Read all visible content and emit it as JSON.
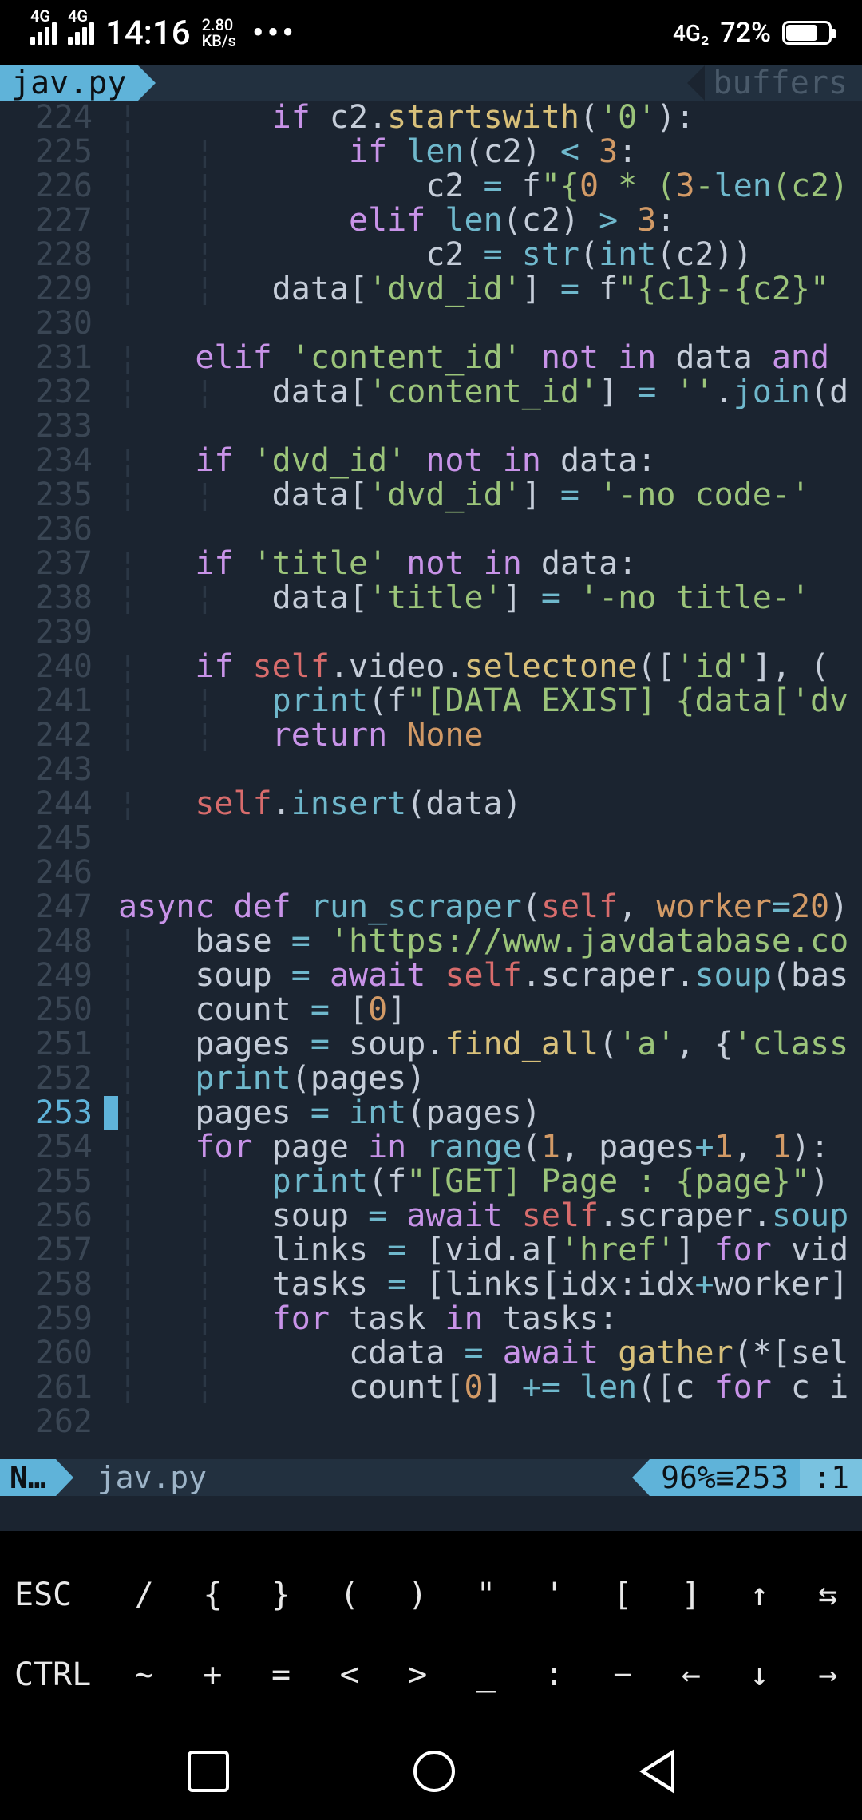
{
  "status": {
    "sig1_label": "4G",
    "sig2_label": "4G",
    "time": "14:16",
    "speed_top": "2.80",
    "speed_bot": "KB/s",
    "net_right": "4G₂",
    "battery_pct": "72%"
  },
  "tab": {
    "filename": "jav.py",
    "right_label": "buffers"
  },
  "statusline": {
    "mode": "N…",
    "file": "jav.py",
    "percent": "96%≡253",
    "col": ":1"
  },
  "keys_row1": [
    "ESC",
    "/",
    "{",
    "}",
    "(",
    ")",
    "\"",
    "'",
    "[",
    "]",
    "↑",
    "⇆"
  ],
  "keys_row2": [
    "CTRL",
    "~",
    "+",
    "=",
    "<",
    ">",
    "_",
    ":",
    "−",
    "←",
    "↓",
    "→"
  ],
  "code": [
    {
      "n": "224",
      "g": "¦       ",
      "seg": [
        [
          "kw",
          "if"
        ],
        [
          "id",
          " c2."
        ],
        [
          "fnY",
          "startswith"
        ],
        [
          "id",
          "("
        ],
        [
          "str",
          "'0'"
        ],
        [
          "id",
          "):"
        ]
      ]
    },
    {
      "n": "225",
      "g": "¦   ¦   ",
      "seg": [
        [
          "id",
          "    "
        ],
        [
          "kw",
          "if"
        ],
        [
          "id",
          " "
        ],
        [
          "fn",
          "len"
        ],
        [
          "id",
          "(c2) "
        ],
        [
          "op",
          "<"
        ],
        [
          "id",
          " "
        ],
        [
          "num",
          "3"
        ],
        [
          "id",
          ":"
        ]
      ]
    },
    {
      "n": "226",
      "g": "¦   ¦   ",
      "seg": [
        [
          "id",
          "        c2 "
        ],
        [
          "op",
          "="
        ],
        [
          "id",
          " f"
        ],
        [
          "str",
          "\"{"
        ],
        [
          "num",
          "0"
        ],
        [
          "str",
          " * ("
        ],
        [
          "num",
          "3"
        ],
        [
          "str",
          "-"
        ],
        [
          "fn",
          "len"
        ],
        [
          "str",
          "(c2)"
        ]
      ]
    },
    {
      "n": "227",
      "g": "¦   ¦   ",
      "seg": [
        [
          "id",
          "    "
        ],
        [
          "kw",
          "elif"
        ],
        [
          "id",
          " "
        ],
        [
          "fn",
          "len"
        ],
        [
          "id",
          "(c2) "
        ],
        [
          "op",
          ">"
        ],
        [
          "id",
          " "
        ],
        [
          "num",
          "3"
        ],
        [
          "id",
          ":"
        ]
      ]
    },
    {
      "n": "228",
      "g": "¦   ¦   ",
      "seg": [
        [
          "id",
          "        c2 "
        ],
        [
          "op",
          "="
        ],
        [
          "id",
          " "
        ],
        [
          "fn",
          "str"
        ],
        [
          "id",
          "("
        ],
        [
          "fn",
          "int"
        ],
        [
          "id",
          "(c2))"
        ]
      ]
    },
    {
      "n": "229",
      "g": "¦   ¦   ",
      "seg": [
        [
          "id",
          "data["
        ],
        [
          "str",
          "'dvd_id'"
        ],
        [
          "id",
          "] "
        ],
        [
          "op",
          "="
        ],
        [
          "id",
          " f"
        ],
        [
          "str",
          "\"{c1}-{c2}\""
        ]
      ]
    },
    {
      "n": "230",
      "g": "",
      "seg": []
    },
    {
      "n": "231",
      "g": "¦   ",
      "seg": [
        [
          "kw",
          "elif"
        ],
        [
          "id",
          " "
        ],
        [
          "str",
          "'content_id'"
        ],
        [
          "id",
          " "
        ],
        [
          "kw",
          "not"
        ],
        [
          "id",
          " "
        ],
        [
          "kw",
          "in"
        ],
        [
          "id",
          " data "
        ],
        [
          "kw",
          "and"
        ],
        [
          "id",
          " "
        ]
      ]
    },
    {
      "n": "232",
      "g": "¦   ¦   ",
      "seg": [
        [
          "id",
          "data["
        ],
        [
          "str",
          "'content_id'"
        ],
        [
          "id",
          "] "
        ],
        [
          "op",
          "="
        ],
        [
          "id",
          " "
        ],
        [
          "str",
          "''"
        ],
        [
          "id",
          "."
        ],
        [
          "fn",
          "join"
        ],
        [
          "id",
          "(d"
        ]
      ]
    },
    {
      "n": "233",
      "g": "",
      "seg": []
    },
    {
      "n": "234",
      "g": "¦   ",
      "seg": [
        [
          "kw",
          "if"
        ],
        [
          "id",
          " "
        ],
        [
          "str",
          "'dvd_id'"
        ],
        [
          "id",
          " "
        ],
        [
          "kw",
          "not"
        ],
        [
          "id",
          " "
        ],
        [
          "kw",
          "in"
        ],
        [
          "id",
          " data:"
        ]
      ]
    },
    {
      "n": "235",
      "g": "¦   ¦   ",
      "seg": [
        [
          "id",
          "data["
        ],
        [
          "str",
          "'dvd_id'"
        ],
        [
          "id",
          "] "
        ],
        [
          "op",
          "="
        ],
        [
          "id",
          " "
        ],
        [
          "str",
          "'-no code-'"
        ]
      ]
    },
    {
      "n": "236",
      "g": "",
      "seg": []
    },
    {
      "n": "237",
      "g": "¦   ",
      "seg": [
        [
          "kw",
          "if"
        ],
        [
          "id",
          " "
        ],
        [
          "str",
          "'title'"
        ],
        [
          "id",
          " "
        ],
        [
          "kw",
          "not"
        ],
        [
          "id",
          " "
        ],
        [
          "kw",
          "in"
        ],
        [
          "id",
          " data:"
        ]
      ]
    },
    {
      "n": "238",
      "g": "¦   ¦   ",
      "seg": [
        [
          "id",
          "data["
        ],
        [
          "str",
          "'title'"
        ],
        [
          "id",
          "] "
        ],
        [
          "op",
          "="
        ],
        [
          "id",
          " "
        ],
        [
          "str",
          "'-no title-'"
        ]
      ]
    },
    {
      "n": "239",
      "g": "",
      "seg": []
    },
    {
      "n": "240",
      "g": "¦   ",
      "seg": [
        [
          "kw",
          "if"
        ],
        [
          "id",
          " "
        ],
        [
          "self",
          "self"
        ],
        [
          "id",
          ".video."
        ],
        [
          "fnY",
          "selectone"
        ],
        [
          "id",
          "(["
        ],
        [
          "str",
          "'id'"
        ],
        [
          "id",
          "], ("
        ]
      ]
    },
    {
      "n": "241",
      "g": "¦   ¦   ",
      "seg": [
        [
          "fn",
          "print"
        ],
        [
          "id",
          "(f"
        ],
        [
          "str",
          "\"[DATA EXIST] {data['dv"
        ]
      ]
    },
    {
      "n": "242",
      "g": "¦   ¦   ",
      "seg": [
        [
          "kw",
          "return"
        ],
        [
          "id",
          " "
        ],
        [
          "none",
          "None"
        ]
      ]
    },
    {
      "n": "243",
      "g": "",
      "seg": []
    },
    {
      "n": "244",
      "g": "¦   ",
      "seg": [
        [
          "self",
          "self"
        ],
        [
          "id",
          "."
        ],
        [
          "fn",
          "insert"
        ],
        [
          "id",
          "(data)"
        ]
      ]
    },
    {
      "n": "245",
      "g": "",
      "seg": []
    },
    {
      "n": "246",
      "g": "",
      "seg": []
    },
    {
      "n": "247",
      "g": "",
      "seg": [
        [
          "kw",
          "async"
        ],
        [
          "id",
          " "
        ],
        [
          "kw",
          "def"
        ],
        [
          "id",
          " "
        ],
        [
          "fn",
          "run_scraper"
        ],
        [
          "id",
          "("
        ],
        [
          "self",
          "self"
        ],
        [
          "id",
          ", "
        ],
        [
          "arg",
          "worker"
        ],
        [
          "op",
          "="
        ],
        [
          "num",
          "20"
        ],
        [
          "id",
          ")"
        ]
      ]
    },
    {
      "n": "248",
      "g": "¦   ",
      "seg": [
        [
          "id",
          "base "
        ],
        [
          "op",
          "="
        ],
        [
          "id",
          " "
        ],
        [
          "str",
          "'https://www.javdatabase.co"
        ]
      ]
    },
    {
      "n": "249",
      "g": "¦   ",
      "seg": [
        [
          "id",
          "soup "
        ],
        [
          "op",
          "="
        ],
        [
          "id",
          " "
        ],
        [
          "kw",
          "await"
        ],
        [
          "id",
          " "
        ],
        [
          "self",
          "self"
        ],
        [
          "id",
          ".scraper."
        ],
        [
          "fn",
          "soup"
        ],
        [
          "id",
          "(bas"
        ]
      ]
    },
    {
      "n": "250",
      "g": "¦   ",
      "seg": [
        [
          "id",
          "count "
        ],
        [
          "op",
          "="
        ],
        [
          "id",
          " ["
        ],
        [
          "num",
          "0"
        ],
        [
          "id",
          "]"
        ]
      ]
    },
    {
      "n": "251",
      "g": "¦   ",
      "seg": [
        [
          "id",
          "pages "
        ],
        [
          "op",
          "="
        ],
        [
          "id",
          " soup."
        ],
        [
          "fnY",
          "find_all"
        ],
        [
          "id",
          "("
        ],
        [
          "str",
          "'a'"
        ],
        [
          "id",
          ", {"
        ],
        [
          "str",
          "'class"
        ]
      ]
    },
    {
      "n": "252",
      "g": "¦   ",
      "seg": [
        [
          "fn",
          "print"
        ],
        [
          "id",
          "(pages)"
        ]
      ]
    },
    {
      "n": "253",
      "g": "¦   ",
      "seg": [
        [
          "id",
          "pages "
        ],
        [
          "op",
          "="
        ],
        [
          "id",
          " "
        ],
        [
          "int",
          "int"
        ],
        [
          "id",
          "(pages)"
        ]
      ],
      "cur": true
    },
    {
      "n": "254",
      "g": "¦   ",
      "seg": [
        [
          "kw",
          "for"
        ],
        [
          "id",
          " page "
        ],
        [
          "kw",
          "in"
        ],
        [
          "id",
          " "
        ],
        [
          "fn",
          "range"
        ],
        [
          "id",
          "("
        ],
        [
          "num",
          "1"
        ],
        [
          "id",
          ", pages"
        ],
        [
          "op",
          "+"
        ],
        [
          "num",
          "1"
        ],
        [
          "id",
          ", "
        ],
        [
          "num",
          "1"
        ],
        [
          "id",
          "):"
        ]
      ]
    },
    {
      "n": "255",
      "g": "¦   ¦   ",
      "seg": [
        [
          "fn",
          "print"
        ],
        [
          "id",
          "(f"
        ],
        [
          "str",
          "\"[GET] Page : {page}\""
        ],
        [
          "id",
          ")"
        ]
      ]
    },
    {
      "n": "256",
      "g": "¦   ¦   ",
      "seg": [
        [
          "id",
          "soup "
        ],
        [
          "op",
          "="
        ],
        [
          "id",
          " "
        ],
        [
          "kw",
          "await"
        ],
        [
          "id",
          " "
        ],
        [
          "self",
          "self"
        ],
        [
          "id",
          ".scraper."
        ],
        [
          "fn",
          "soup"
        ]
      ]
    },
    {
      "n": "257",
      "g": "¦   ¦   ",
      "seg": [
        [
          "id",
          "links "
        ],
        [
          "op",
          "="
        ],
        [
          "id",
          " [vid.a["
        ],
        [
          "str",
          "'href'"
        ],
        [
          "id",
          "] "
        ],
        [
          "kw",
          "for"
        ],
        [
          "id",
          " vid"
        ]
      ]
    },
    {
      "n": "258",
      "g": "¦   ¦   ",
      "seg": [
        [
          "id",
          "tasks "
        ],
        [
          "op",
          "="
        ],
        [
          "id",
          " [links[idx:idx"
        ],
        [
          "op",
          "+"
        ],
        [
          "id",
          "worker]"
        ]
      ]
    },
    {
      "n": "259",
      "g": "¦   ¦   ",
      "seg": [
        [
          "kw",
          "for"
        ],
        [
          "id",
          " task "
        ],
        [
          "kw",
          "in"
        ],
        [
          "id",
          " tasks:"
        ]
      ]
    },
    {
      "n": "260",
      "g": "¦   ¦   ",
      "seg": [
        [
          "id",
          "    cdata "
        ],
        [
          "op",
          "="
        ],
        [
          "id",
          " "
        ],
        [
          "kw",
          "await"
        ],
        [
          "id",
          " "
        ],
        [
          "fnY",
          "gather"
        ],
        [
          "id",
          "(*[sel"
        ]
      ]
    },
    {
      "n": "261",
      "g": "¦   ¦   ",
      "seg": [
        [
          "id",
          "    count["
        ],
        [
          "num",
          "0"
        ],
        [
          "id",
          "] "
        ],
        [
          "op",
          "+="
        ],
        [
          "id",
          " "
        ],
        [
          "fn",
          "len"
        ],
        [
          "id",
          "([c "
        ],
        [
          "kw",
          "for"
        ],
        [
          "id",
          " c i"
        ]
      ]
    },
    {
      "n": "262",
      "g": "",
      "seg": []
    }
  ],
  "base_indent": {
    "224": 5,
    "225": 5,
    "226": 5,
    "227": 5,
    "228": 5,
    "229": 5,
    "231": 4,
    "232": 4,
    "234": 4,
    "235": 4,
    "237": 4,
    "238": 4,
    "240": 4,
    "241": 4,
    "242": 4,
    "244": 4,
    "247": 3,
    "248": 4,
    "249": 4,
    "250": 4,
    "251": 4,
    "252": 4,
    "253": 4,
    "254": 4,
    "255": 4,
    "256": 4,
    "257": 4,
    "258": 4,
    "259": 4,
    "260": 4,
    "261": 4
  }
}
